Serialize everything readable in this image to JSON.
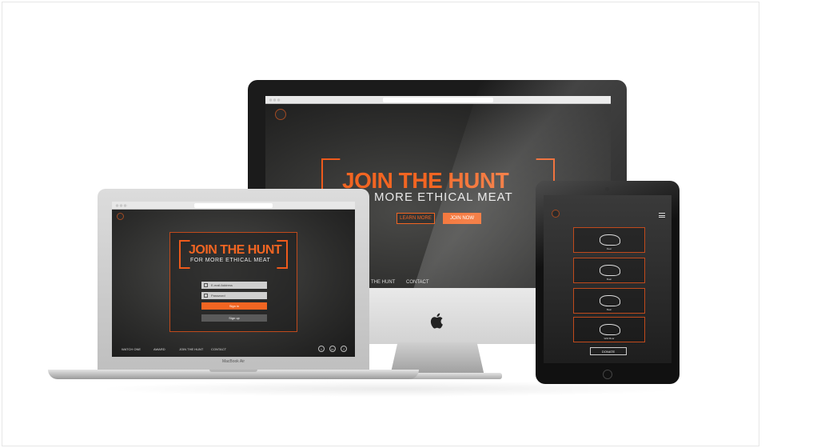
{
  "imac": {
    "hero_title": "JOIN THE HUNT",
    "hero_subtitle": "MORE ETHICAL MEAT",
    "left_button": "LEARN MORE",
    "right_button": "JOIN NOW",
    "nav_items": [
      "THE HUNT",
      "CONTACT"
    ]
  },
  "macbook": {
    "hero_title": "JOIN THE HUNT",
    "hero_subtitle": "FOR MORE ETHICAL MEAT",
    "email_placeholder": "E-mail Address",
    "password_placeholder": "Password",
    "signin_button": "Sign in",
    "signup_button": "Sign up",
    "nav_items": [
      "WATCH ONE",
      "AWARD",
      "JOIN THE HUNT",
      "CONTACT"
    ],
    "social_icons": [
      "twitter-icon",
      "linkedin-icon",
      "facebook-icon"
    ],
    "device_label": "MacBook Air"
  },
  "ipad": {
    "animals": [
      "Deer",
      "Boar",
      "Bear",
      "Wild Boar"
    ],
    "button": "DONATE"
  },
  "colors": {
    "accent": "#f26522",
    "background": "#2b2b2b"
  }
}
